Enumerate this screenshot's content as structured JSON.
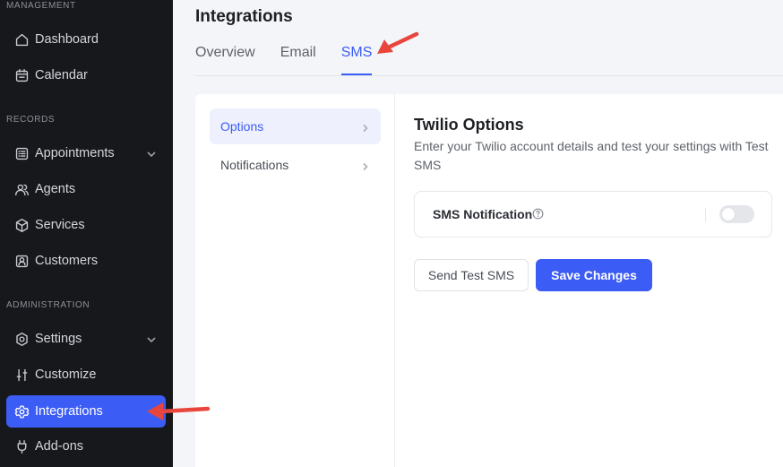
{
  "sidebar": {
    "sections": [
      {
        "label": "MANAGEMENT"
      },
      {
        "label": "RECORDS"
      },
      {
        "label": "ADMINISTRATION"
      }
    ],
    "items": [
      {
        "label": "Dashboard",
        "icon": "house-icon"
      },
      {
        "label": "Calendar",
        "icon": "calendar-icon"
      },
      {
        "label": "Appointments",
        "icon": "list-icon",
        "expandable": true
      },
      {
        "label": "Agents",
        "icon": "users-icon"
      },
      {
        "label": "Services",
        "icon": "box-icon"
      },
      {
        "label": "Customers",
        "icon": "user-card-icon"
      },
      {
        "label": "Settings",
        "icon": "gear-icon",
        "expandable": true
      },
      {
        "label": "Customize",
        "icon": "sliders-icon"
      },
      {
        "label": "Integrations",
        "icon": "integration-gear-icon",
        "active": true
      },
      {
        "label": "Add-ons",
        "icon": "plug-icon"
      }
    ]
  },
  "page": {
    "title": "Integrations",
    "tabs": [
      {
        "label": "Overview"
      },
      {
        "label": "Email"
      },
      {
        "label": "SMS",
        "active": true
      }
    ]
  },
  "subnav": {
    "items": [
      {
        "label": "Options",
        "active": true
      },
      {
        "label": "Notifications"
      }
    ]
  },
  "content": {
    "title": "Twilio Options",
    "description": "Enter your Twilio account details and test your settings with Test SMS",
    "setting": {
      "label": "SMS Notification",
      "enabled": false
    },
    "buttons": {
      "test_label": "Send Test SMS",
      "save_label": "Save Changes"
    }
  },
  "colors": {
    "accent": "#3b5cf5",
    "sidebar_bg": "#17181c",
    "annotation_arrow": "#e8453c"
  }
}
